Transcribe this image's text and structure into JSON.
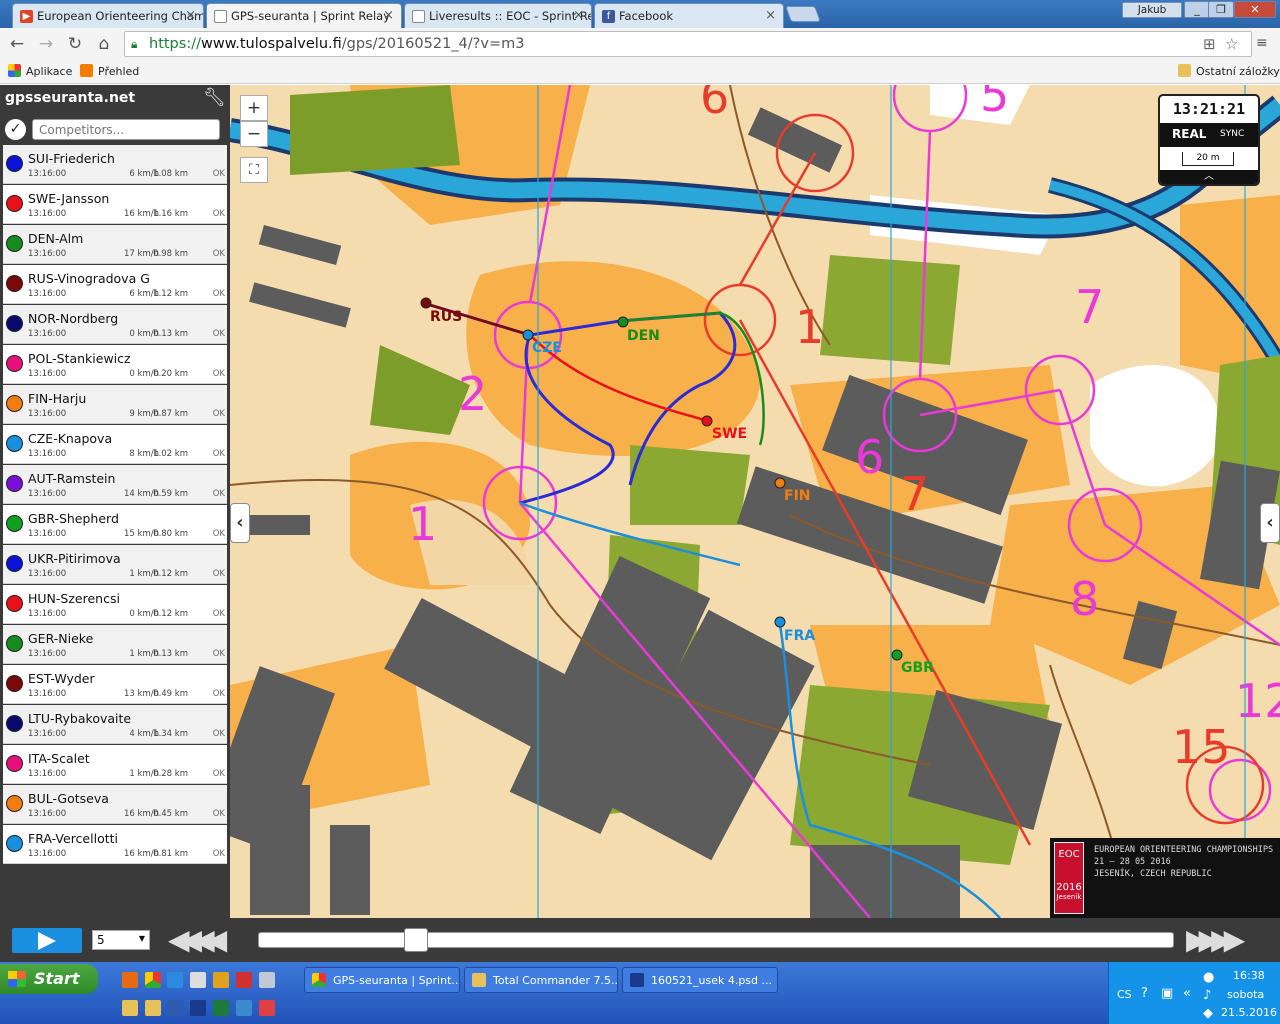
{
  "tabs": [
    {
      "title": "European Orienteering Cham",
      "icon": "eoc-flag-icon",
      "color": "#d42"
    },
    {
      "title": "GPS-seuranta | Sprint Relay",
      "icon": "doc-icon",
      "color": "#888",
      "active": true
    },
    {
      "title": "Liveresults :: EOC - Sprint Re",
      "icon": "doc-icon",
      "color": "#888"
    },
    {
      "title": "Facebook",
      "icon": "facebook-icon",
      "color": "#3b5998"
    }
  ],
  "window": {
    "user": "Jakub"
  },
  "address": {
    "scheme": "https://",
    "host": "www.tulospalvelu.fi",
    "path": "/gps/20160521_4/?v=m3"
  },
  "bookmarks": {
    "apps": "Aplikace",
    "overview": "Přehled",
    "other": "Ostatní záložky"
  },
  "sidebar": {
    "brand": "gpsseuranta.net",
    "search_placeholder": "Competitors...",
    "competitors": [
      {
        "name": "SUI-Friederich",
        "time": "13:16:00",
        "speed": "6 km/h",
        "dist": "1.08 km",
        "status": "OK",
        "color": "#0a12d8"
      },
      {
        "name": "SWE-Jansson",
        "time": "13:16:00",
        "speed": "16 km/h",
        "dist": "1.16 km",
        "status": "OK",
        "color": "#e8101a"
      },
      {
        "name": "DEN-Alm",
        "time": "13:16:00",
        "speed": "17 km/h",
        "dist": "0.98 km",
        "status": "OK",
        "color": "#148c1e"
      },
      {
        "name": "RUS-Vinogradova G",
        "time": "13:16:00",
        "speed": "6 km/h",
        "dist": "1.12 km",
        "status": "OK",
        "color": "#7a0a0a"
      },
      {
        "name": "NOR-Nordberg",
        "time": "13:16:00",
        "speed": "0 km/h",
        "dist": "0.13 km",
        "status": "OK",
        "color": "#0a0a6e"
      },
      {
        "name": "POL-Stankiewicz",
        "time": "13:16:00",
        "speed": "0 km/h",
        "dist": "0.20 km",
        "status": "OK",
        "color": "#e8107a"
      },
      {
        "name": "FIN-Harju",
        "time": "13:16:00",
        "speed": "9 km/h",
        "dist": "0.87 km",
        "status": "OK",
        "color": "#f07d10"
      },
      {
        "name": "CZE-Knapova",
        "time": "13:16:00",
        "speed": "8 km/h",
        "dist": "1.02 km",
        "status": "OK",
        "color": "#1a8fe0"
      },
      {
        "name": "AUT-Ramstein",
        "time": "13:16:00",
        "speed": "14 km/h",
        "dist": "0.59 km",
        "status": "OK",
        "color": "#7a10d8"
      },
      {
        "name": "GBR-Shepherd",
        "time": "13:16:00",
        "speed": "15 km/h",
        "dist": "0.80 km",
        "status": "OK",
        "color": "#10a020"
      },
      {
        "name": "UKR-Pitirimova",
        "time": "13:16:00",
        "speed": "1 km/h",
        "dist": "0.12 km",
        "status": "OK",
        "color": "#0a12d8"
      },
      {
        "name": "HUN-Szerencsi",
        "time": "13:16:00",
        "speed": "0 km/h",
        "dist": "0.12 km",
        "status": "OK",
        "color": "#e8101a"
      },
      {
        "name": "GER-Nieke",
        "time": "13:16:00",
        "speed": "1 km/h",
        "dist": "0.13 km",
        "status": "OK",
        "color": "#148c1e"
      },
      {
        "name": "EST-Wyder",
        "time": "13:16:00",
        "speed": "13 km/h",
        "dist": "0.49 km",
        "status": "OK",
        "color": "#7a0a0a"
      },
      {
        "name": "LTU-Rybakovaite",
        "time": "13:16:00",
        "speed": "4 km/h",
        "dist": "1.34 km",
        "status": "OK",
        "color": "#0a0a6e"
      },
      {
        "name": "ITA-Scalet",
        "time": "13:16:00",
        "speed": "1 km/h",
        "dist": "0.28 km",
        "status": "OK",
        "color": "#e8107a"
      },
      {
        "name": "BUL-Gotseva",
        "time": "13:16:00",
        "speed": "16 km/h",
        "dist": "0.45 km",
        "status": "OK",
        "color": "#f07d10"
      },
      {
        "name": "FRA-Vercellotti",
        "time": "13:16:00",
        "speed": "16 km/h",
        "dist": "0.81 km",
        "status": "OK",
        "color": "#1a8fe0"
      }
    ]
  },
  "map": {
    "zoom_in": "+",
    "zoom_out": "−",
    "clock": "13:21:21",
    "mode": "REAL",
    "sync": "SYNC",
    "scale": "20 m",
    "runner_labels": [
      "RUS",
      "CZE",
      "DEN",
      "SWE",
      "FIN",
      "FRA",
      "GBR"
    ],
    "control_numbers": [
      "1",
      "2",
      "1",
      "6",
      "6",
      "7",
      "7",
      "5",
      "8",
      "15",
      "12"
    ],
    "eoc": {
      "logo_top": "EOC",
      "logo_year": "2016",
      "logo_place": "Jeseník",
      "line1": "EUROPEAN ORIENTEERING CHAMPIONSHIPS",
      "line2": "21 – 28 05 2016",
      "line3": "JESENÍK, CZECH REPUBLIC"
    }
  },
  "player": {
    "speed": "5"
  },
  "taskbar": {
    "start": "Start",
    "tasks": [
      "GPS-seuranta | Sprint...",
      "Total Commander 7.5...",
      "160521_usek 4.psd ..."
    ],
    "lang": "CS",
    "time": "16:38",
    "day": "sobota",
    "date": "21.5.2016"
  }
}
